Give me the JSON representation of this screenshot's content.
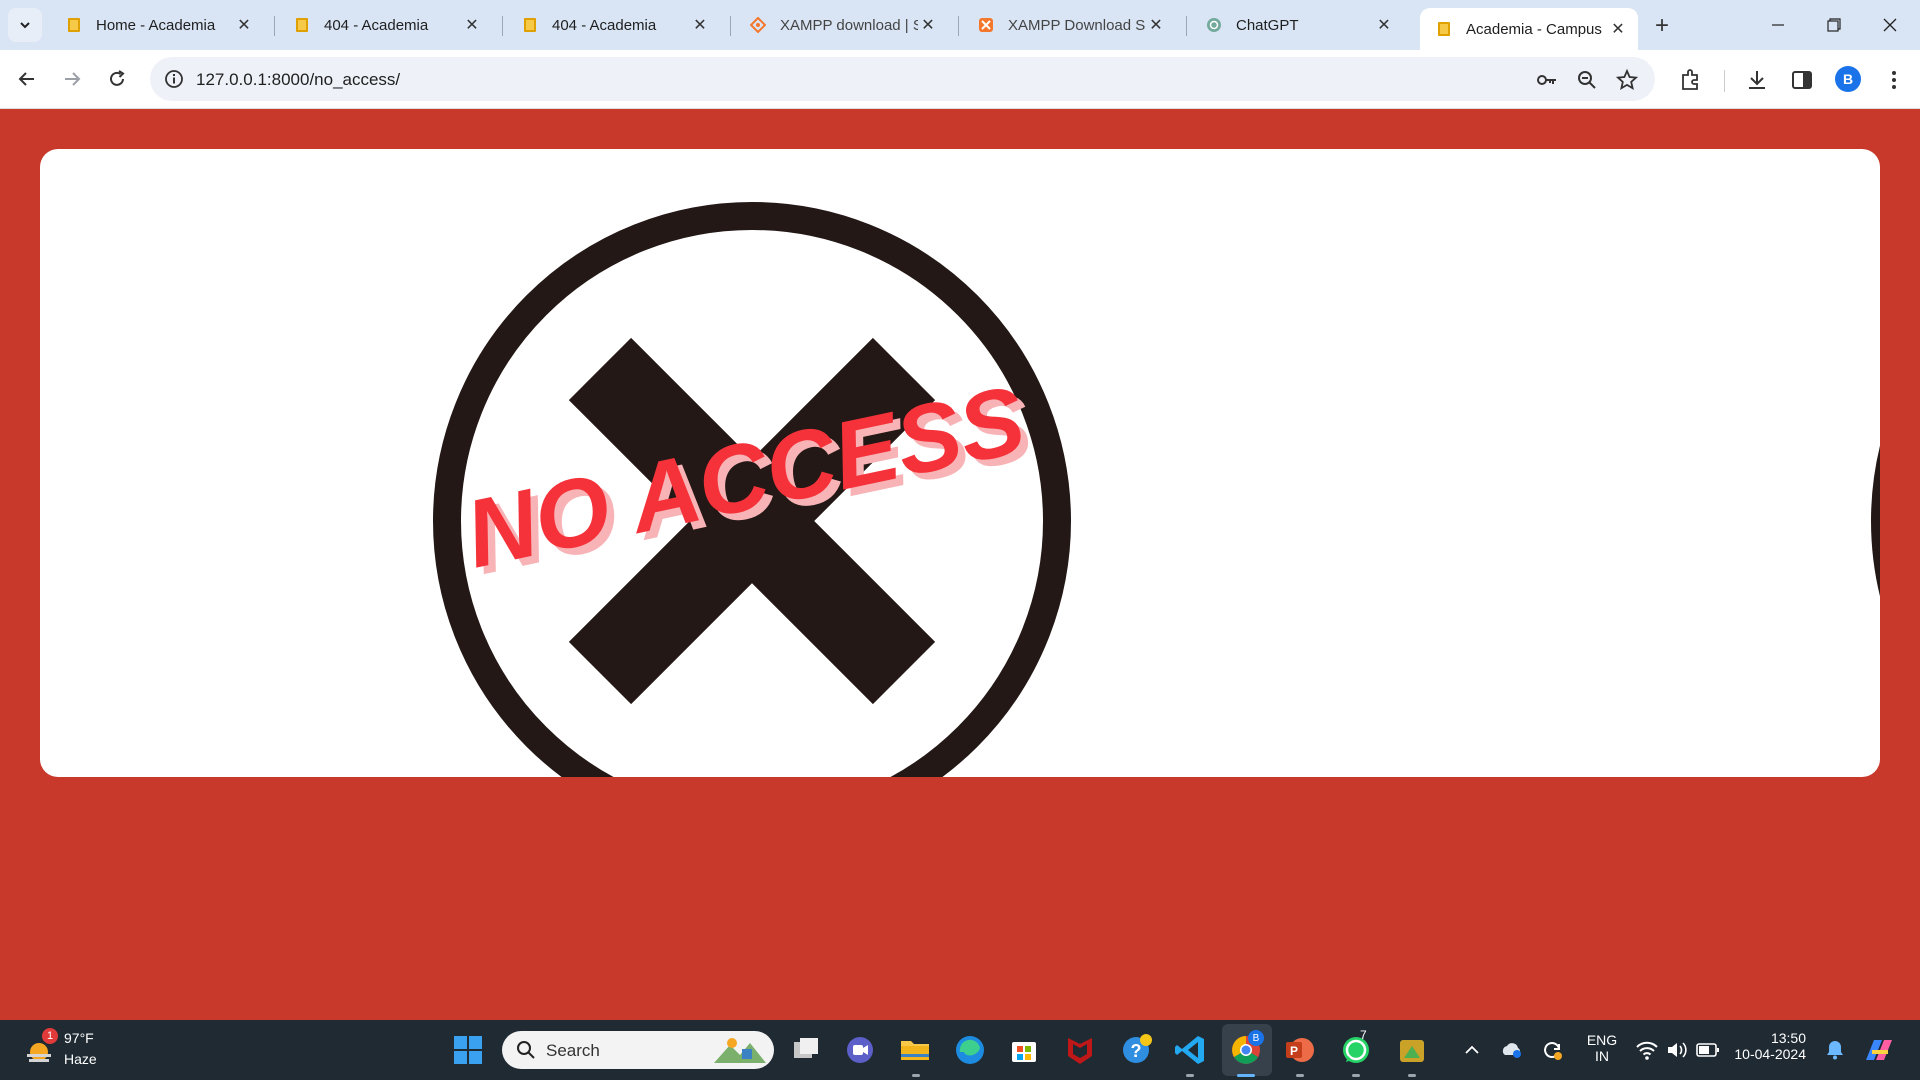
{
  "browser": {
    "tabs": [
      {
        "title": "Home - Academia",
        "favicon": "book-icon",
        "active": false
      },
      {
        "title": "404 - Academia",
        "favicon": "book-icon",
        "active": false
      },
      {
        "title": "404 - Academia",
        "favicon": "book-icon",
        "active": false
      },
      {
        "title": "XAMPP download | S",
        "favicon": "xampp-icon",
        "active": false
      },
      {
        "title": "XAMPP Download Su",
        "favicon": "xampp-icon",
        "active": false
      },
      {
        "title": "ChatGPT",
        "favicon": "chatgpt-icon",
        "active": false
      },
      {
        "title": "Academia - Campus",
        "favicon": "book-icon",
        "active": true
      }
    ],
    "close_glyph": "✕",
    "new_tab_glyph": "+",
    "url": "127.0.0.1:8000/no_access/",
    "profile_initial": "B"
  },
  "page": {
    "background_color": "#c8392b",
    "banner_text": "NO ACCESS",
    "banner_color": "#f5323a",
    "x_color": "#231815"
  },
  "taskbar": {
    "weather": {
      "temperature": "97°F",
      "condition": "Haze",
      "badge": "1"
    },
    "search_placeholder": "Search",
    "apps": [
      "windows-start-icon",
      "task-view-icon",
      "meet-icon",
      "file-explorer-icon",
      "edge-icon",
      "store-icon",
      "mcafee-icon",
      "help-icon",
      "vscode-icon",
      "chrome-icon",
      "powerpoint-icon",
      "whatsapp-icon",
      "app-icon"
    ],
    "chrome_badge": "B",
    "whatsapp_badge": "7",
    "language": {
      "line1": "ENG",
      "line2": "IN"
    },
    "time": "13:50",
    "date": "10-04-2024"
  }
}
